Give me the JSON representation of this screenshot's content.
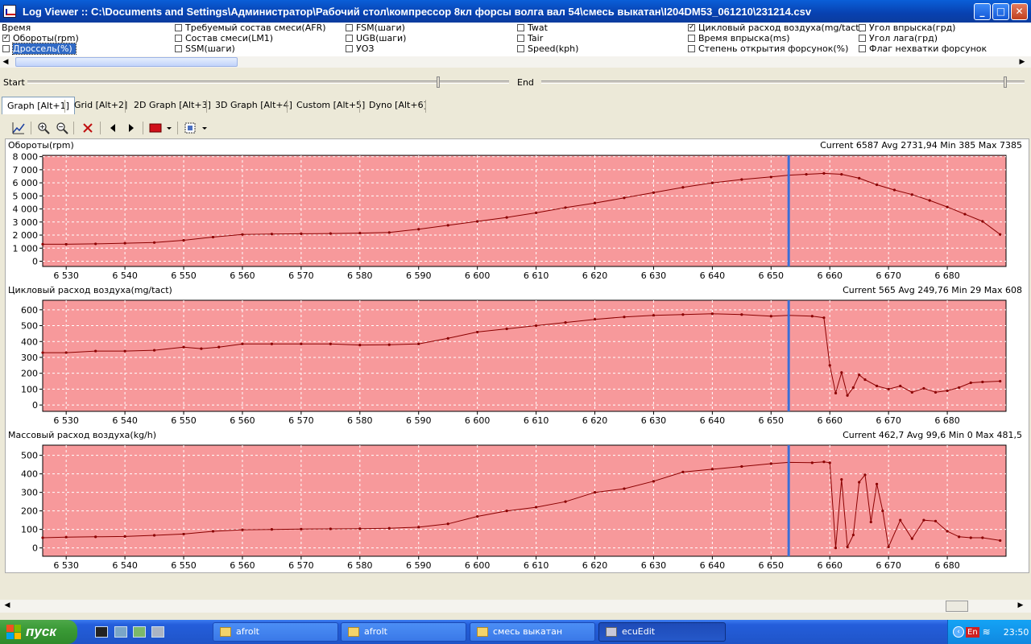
{
  "window": {
    "title": "Log Viewer :: C:\\Documents and Settings\\Администратор\\Рабочий стол\\компрессор 8кл форсы волга вал 54\\смесь выкатан\\I204DM53_061210\\231214.csv"
  },
  "params": [
    [
      {
        "label": "Время",
        "checked": null
      },
      {
        "label": "Обороты(rpm)",
        "checked": true
      },
      {
        "label": "Дроссель(%)",
        "checked": false,
        "selected": true
      }
    ],
    [
      {
        "label": "Требуемый состав смеси(AFR)",
        "checked": false
      },
      {
        "label": "Состав смеси(LM1)",
        "checked": false
      },
      {
        "label": "SSM(шаги)",
        "checked": false
      }
    ],
    [
      {
        "label": "FSM(шаги)",
        "checked": false
      },
      {
        "label": "UGB(шаги)",
        "checked": false
      },
      {
        "label": "УОЗ",
        "checked": false
      }
    ],
    [
      {
        "label": "Twat",
        "checked": false
      },
      {
        "label": "Tair",
        "checked": false
      },
      {
        "label": "Speed(kph)",
        "checked": false
      }
    ],
    [
      {
        "label": "Цикловый расход воздуха(mg/tact)",
        "checked": true
      },
      {
        "label": "Время впрыска(ms)",
        "checked": false
      },
      {
        "label": "Степень открытия форсунок(%)",
        "checked": false
      }
    ],
    [
      {
        "label": "Угол впрыска(грд)",
        "checked": false
      },
      {
        "label": "Угол лага(грд)",
        "checked": false
      },
      {
        "label": "Флаг нехватки форсунок",
        "checked": false
      }
    ]
  ],
  "range": {
    "start_label": "Start",
    "end_label": "End"
  },
  "tabs": [
    "Graph [Alt+1]",
    "Grid [Alt+2]",
    "2D Graph [Alt+3]",
    "3D Graph [Alt+4]",
    "Custom [Alt+5]",
    "Dyno [Alt+6]"
  ],
  "toolbar": {
    "icons": [
      "chart-properties-icon",
      "zoom-in-icon",
      "zoom-out-icon",
      "delete-icon",
      "previous-icon",
      "next-icon",
      "color-icon",
      "grid-layout-icon"
    ]
  },
  "colors": {
    "plot_bg": "#f7999b",
    "plot_border": "#000000",
    "line": "#8b0000",
    "cursor": "#3a6fd8",
    "grid": "#ffffff"
  },
  "chart_data": [
    {
      "type": "line",
      "title": "Обороты(rpm)",
      "stats": "Current 6587 Avg 2731,94 Min 385 Max 7385",
      "xlim": [
        6526,
        6690
      ],
      "ylim": [
        -400,
        8100
      ],
      "yticks": [
        0,
        1000,
        2000,
        3000,
        4000,
        5000,
        6000,
        7000,
        8000
      ],
      "ytick_labels": [
        "0",
        "1 000",
        "2 000",
        "3 000",
        "4 000",
        "5 000",
        "6 000",
        "7 000",
        "8 000"
      ],
      "xticks": [
        6530,
        6540,
        6550,
        6560,
        6570,
        6580,
        6590,
        6600,
        6610,
        6620,
        6630,
        6640,
        6650,
        6660,
        6670,
        6680
      ],
      "xtick_labels": [
        "6 530",
        "6 540",
        "6 550",
        "6 560",
        "6 570",
        "6 580",
        "6 590",
        "6 600",
        "6 610",
        "6 620",
        "6 630",
        "6 640",
        "6 650",
        "6 660",
        "6 670",
        "6 680"
      ],
      "cursor_x": 6653,
      "x": [
        6526,
        6530,
        6535,
        6540,
        6545,
        6550,
        6555,
        6560,
        6565,
        6570,
        6575,
        6580,
        6585,
        6590,
        6595,
        6600,
        6605,
        6610,
        6615,
        6620,
        6625,
        6630,
        6635,
        6640,
        6645,
        6650,
        6653,
        6656,
        6659,
        6662,
        6665,
        6668,
        6671,
        6674,
        6677,
        6680,
        6683,
        6686,
        6689
      ],
      "y": [
        1300,
        1300,
        1330,
        1380,
        1430,
        1600,
        1850,
        2050,
        2080,
        2100,
        2120,
        2150,
        2200,
        2450,
        2750,
        3050,
        3350,
        3700,
        4100,
        4450,
        4850,
        5250,
        5650,
        6000,
        6250,
        6450,
        6587,
        6650,
        6720,
        6650,
        6350,
        5850,
        5450,
        5100,
        4650,
        4150,
        3600,
        3050,
        2050
      ]
    },
    {
      "type": "line",
      "title": "Цикловый расход воздуха(mg/tact)",
      "stats": "Current 565 Avg 249,76 Min 29 Max 608",
      "xlim": [
        6526,
        6690
      ],
      "ylim": [
        -40,
        660
      ],
      "yticks": [
        0,
        100,
        200,
        300,
        400,
        500,
        600
      ],
      "ytick_labels": [
        "0",
        "100",
        "200",
        "300",
        "400",
        "500",
        "600"
      ],
      "xticks": [
        6530,
        6540,
        6550,
        6560,
        6570,
        6580,
        6590,
        6600,
        6610,
        6620,
        6630,
        6640,
        6650,
        6660,
        6670,
        6680
      ],
      "xtick_labels": [
        "6 530",
        "6 540",
        "6 550",
        "6 560",
        "6 570",
        "6 580",
        "6 590",
        "6 600",
        "6 610",
        "6 620",
        "6 630",
        "6 640",
        "6 650",
        "6 660",
        "6 670",
        "6 680"
      ],
      "cursor_x": 6653,
      "x": [
        6526,
        6530,
        6535,
        6540,
        6545,
        6550,
        6553,
        6556,
        6560,
        6565,
        6570,
        6575,
        6580,
        6585,
        6590,
        6595,
        6600,
        6605,
        6610,
        6615,
        6620,
        6625,
        6630,
        6635,
        6640,
        6645,
        6650,
        6653,
        6657,
        6659,
        6660,
        6661,
        6662,
        6663,
        6664,
        6665,
        6666,
        6668,
        6670,
        6672,
        6674,
        6676,
        6678,
        6680,
        6682,
        6684,
        6686,
        6689
      ],
      "y": [
        330,
        330,
        340,
        340,
        345,
        365,
        355,
        365,
        385,
        385,
        385,
        385,
        378,
        380,
        385,
        420,
        460,
        480,
        500,
        520,
        540,
        555,
        565,
        570,
        575,
        570,
        560,
        565,
        560,
        550,
        250,
        75,
        205,
        60,
        110,
        190,
        160,
        120,
        100,
        120,
        80,
        105,
        80,
        90,
        110,
        140,
        145,
        150
      ]
    },
    {
      "type": "line",
      "title": "Массовый расход воздуха(kg/h)",
      "stats": "Current 462,7 Avg 99,6 Min 0 Max 481,5",
      "xlim": [
        6526,
        6690
      ],
      "ylim": [
        -45,
        555
      ],
      "yticks": [
        0,
        100,
        200,
        300,
        400,
        500
      ],
      "ytick_labels": [
        "0",
        "100",
        "200",
        "300",
        "400",
        "500"
      ],
      "xticks": [
        6530,
        6540,
        6550,
        6560,
        6570,
        6580,
        6590,
        6600,
        6610,
        6620,
        6630,
        6640,
        6650,
        6660,
        6670,
        6680
      ],
      "xtick_labels": [
        "6 530",
        "6 540",
        "6 550",
        "6 560",
        "6 570",
        "6 580",
        "6 590",
        "6 600",
        "6 610",
        "6 620",
        "6 630",
        "6 640",
        "6 650",
        "6 660",
        "6 670",
        "6 680"
      ],
      "cursor_x": 6653,
      "x": [
        6526,
        6530,
        6535,
        6540,
        6545,
        6550,
        6555,
        6560,
        6565,
        6570,
        6575,
        6580,
        6585,
        6590,
        6595,
        6600,
        6605,
        6610,
        6615,
        6620,
        6625,
        6630,
        6635,
        6640,
        6645,
        6650,
        6653,
        6657,
        6659,
        6660,
        6661,
        6662,
        6663,
        6664,
        6665,
        6666,
        6667,
        6668,
        6669,
        6670,
        6672,
        6674,
        6676,
        6678,
        6680,
        6682,
        6684,
        6686,
        6689
      ],
      "y": [
        55,
        58,
        60,
        62,
        68,
        75,
        90,
        98,
        100,
        102,
        103,
        104,
        106,
        112,
        130,
        170,
        200,
        220,
        250,
        300,
        320,
        360,
        410,
        425,
        440,
        455,
        462,
        460,
        465,
        460,
        0,
        370,
        5,
        70,
        355,
        395,
        140,
        345,
        200,
        5,
        150,
        50,
        150,
        145,
        90,
        60,
        55,
        55,
        40
      ]
    }
  ],
  "taskbar": {
    "start_label": "пуск",
    "tasks": [
      {
        "label": "afrolt",
        "active": false
      },
      {
        "label": "afrolt",
        "active": false
      },
      {
        "label": "смесь выкатан",
        "active": false
      },
      {
        "label": "ecuEdit",
        "active": true
      }
    ],
    "lang": "En",
    "clock": "23:50"
  }
}
